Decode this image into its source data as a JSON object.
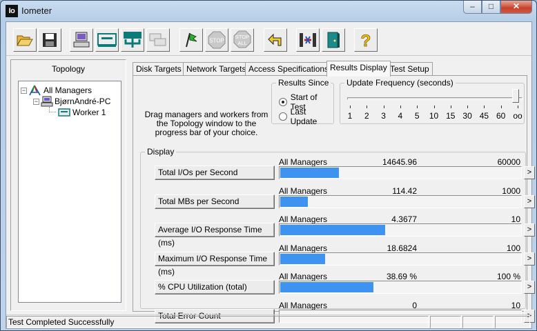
{
  "window": {
    "title": "Iometer",
    "app_icon_text": "Io",
    "controls": {
      "minimize": "–",
      "maximize": "□",
      "close": "✕"
    }
  },
  "toolbar": {
    "buttons": [
      {
        "name": "open-config",
        "icon": "folder-open-icon"
      },
      {
        "name": "save-config",
        "icon": "floppy-disk-icon"
      },
      {
        "name": "start-new-manager",
        "icon": "computer-icon"
      },
      {
        "name": "start-disk-worker",
        "icon": "disk-worker-icon"
      },
      {
        "name": "start-network-worker",
        "icon": "network-worker-icon"
      },
      {
        "name": "duplicate-worker",
        "icon": "copy-worker-icon"
      },
      {
        "name": "start-tests",
        "icon": "green-flag-icon"
      },
      {
        "name": "stop-current-test",
        "icon": "stop-sign-icon",
        "label": "STOP"
      },
      {
        "name": "stop-all-tests",
        "icon": "stop-all-icon",
        "label": "STOP",
        "sub": "ALL"
      },
      {
        "name": "reset-workers",
        "icon": "reset-arrow-icon"
      },
      {
        "name": "disconnect-managers",
        "icon": "disconnect-icon"
      },
      {
        "name": "exit",
        "icon": "exit-door-icon"
      },
      {
        "name": "about",
        "icon": "question-icon",
        "label": "?"
      }
    ]
  },
  "topology": {
    "title": "Topology",
    "tree": [
      {
        "label": "All Managers",
        "expander": "−",
        "icon": "all-managers-icon",
        "level": 0
      },
      {
        "label": "BjørnAndré-PC",
        "expander": "−",
        "icon": "computer-icon",
        "level": 1
      },
      {
        "label": "Worker 1",
        "icon": "worker-disk-icon",
        "level": 2
      }
    ]
  },
  "tabs": [
    {
      "label": "Disk Targets",
      "active": false
    },
    {
      "label": "Network Targets",
      "active": false
    },
    {
      "label": "Access Specifications",
      "active": false
    },
    {
      "label": "Results Display",
      "active": true
    },
    {
      "label": "Test Setup",
      "active": false
    }
  ],
  "results": {
    "drag_hint": "Drag managers and workers from the Topology window to the progress bar of your choice.",
    "results_since": {
      "label": "Results Since",
      "options": [
        {
          "label": "Start of Test",
          "selected": true
        },
        {
          "label": "Last Update",
          "selected": false
        }
      ]
    },
    "update_frequency": {
      "label": "Update Frequency (seconds)",
      "ticks": [
        "1",
        "2",
        "3",
        "4",
        "5",
        "10",
        "15",
        "30",
        "45",
        "60",
        "oo"
      ],
      "selected": "oo"
    },
    "display": {
      "label": "Display",
      "rows": [
        {
          "button": "Total I/Os per Second",
          "source": "All Managers",
          "value": "14645.96",
          "max": "60000",
          "fraction": 0.244
        },
        {
          "button": "Total MBs per Second",
          "source": "All Managers",
          "value": "114.42",
          "max": "1000",
          "fraction": 0.114
        },
        {
          "button": "Average I/O Response Time (ms)",
          "source": "All Managers",
          "value": "4.3677",
          "max": "10",
          "fraction": 0.4368
        },
        {
          "button": "Maximum I/O Response Time (ms)",
          "source": "All Managers",
          "value": "18.6824",
          "max": "100",
          "fraction": 0.1868
        },
        {
          "button": "% CPU Utilization (total)",
          "source": "All Managers",
          "value": "38.69 %",
          "max": "100 %",
          "fraction": 0.3869
        },
        {
          "button": "Total Error Count",
          "source": "All Managers",
          "value": "0",
          "max": "10",
          "fraction": 0
        }
      ],
      "arrow_label": ">"
    }
  },
  "status_bar": {
    "message": "Test Completed Successfully"
  },
  "colors": {
    "progress_fill": "#3d93ef",
    "window_frame": "#b5cde6",
    "close_button": "#c7412d"
  }
}
